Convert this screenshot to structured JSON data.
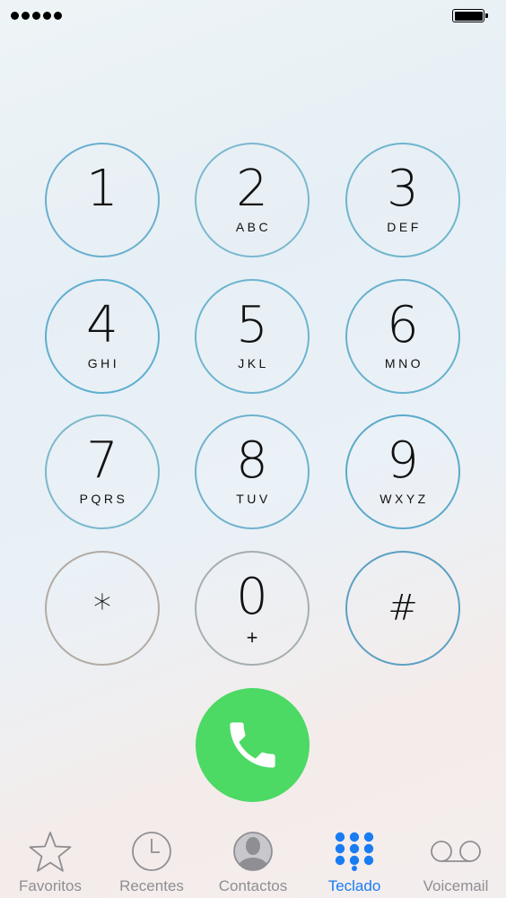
{
  "keypad": {
    "keys": [
      {
        "digit": "1",
        "letters": ""
      },
      {
        "digit": "2",
        "letters": "ABC"
      },
      {
        "digit": "3",
        "letters": "DEF"
      },
      {
        "digit": "4",
        "letters": "GHI"
      },
      {
        "digit": "5",
        "letters": "JKL"
      },
      {
        "digit": "6",
        "letters": "MNO"
      },
      {
        "digit": "7",
        "letters": "PQRS"
      },
      {
        "digit": "8",
        "letters": "TUV"
      },
      {
        "digit": "9",
        "letters": "WXYZ"
      },
      {
        "digit": "*",
        "letters": ""
      },
      {
        "digit": "0",
        "letters": "+"
      },
      {
        "digit": "#",
        "letters": ""
      }
    ]
  },
  "call": {
    "icon": "phone-icon",
    "color": "#4cd964"
  },
  "tabs": [
    {
      "label": "Favoritos",
      "icon": "star-icon",
      "active": false
    },
    {
      "label": "Recentes",
      "icon": "clock-icon",
      "active": false
    },
    {
      "label": "Contactos",
      "icon": "contact-icon",
      "active": false
    },
    {
      "label": "Teclado",
      "icon": "keypad-icon",
      "active": true
    },
    {
      "label": "Voicemail",
      "icon": "voicemail-icon",
      "active": false
    }
  ],
  "colors": {
    "accent": "#1a7cf3",
    "inactive": "#8e8e93",
    "ring": "#6fb3cf"
  }
}
